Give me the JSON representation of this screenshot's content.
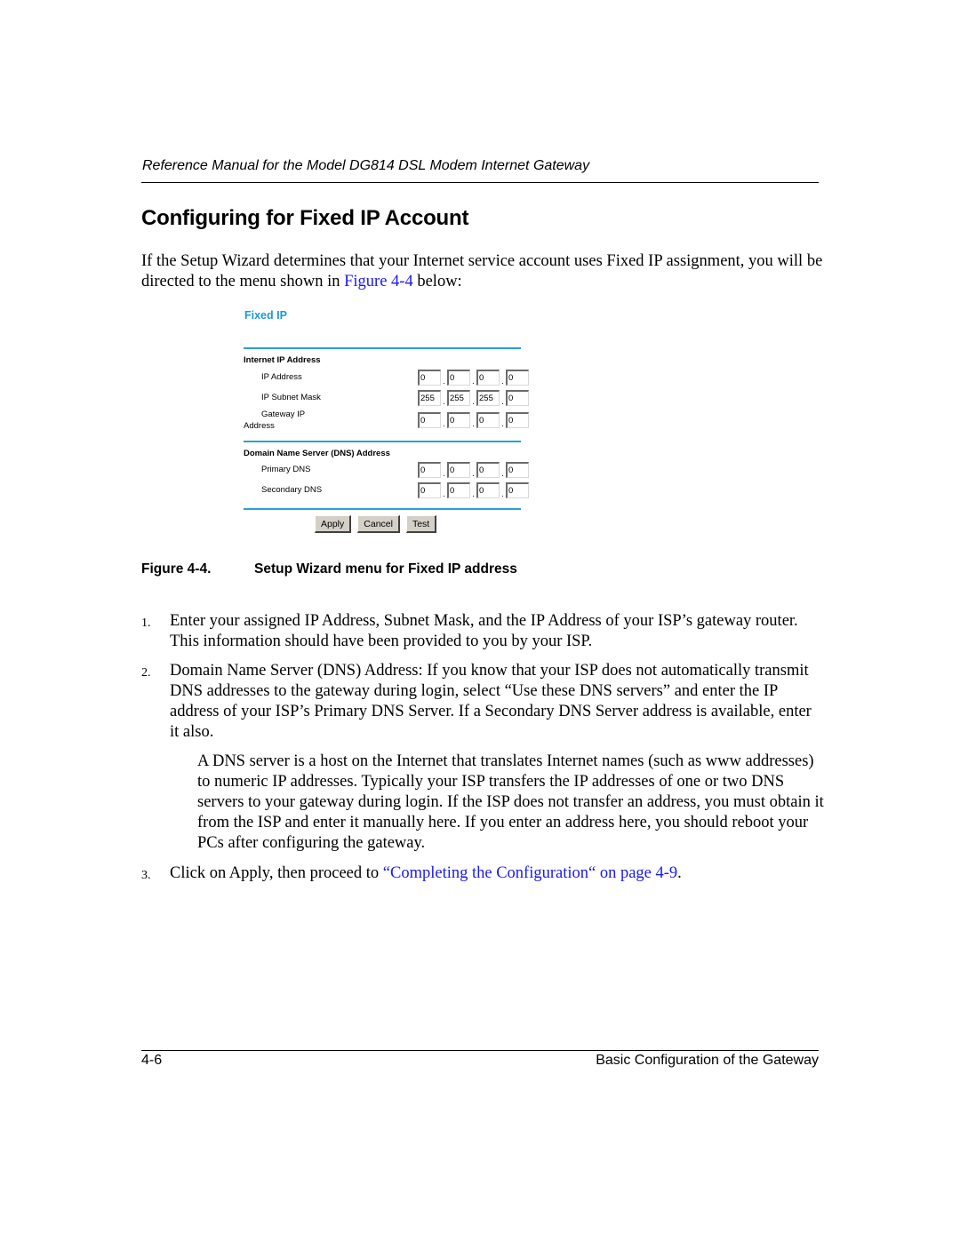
{
  "running_header": "Reference Manual for the Model DG814 DSL Modem Internet Gateway",
  "page_title": "Configuring for Fixed IP Account",
  "intro": {
    "text_before_link": "If the Setup Wizard determines that your Internet service account uses Fixed IP assignment, you will be directed to the menu shown in ",
    "link_text": "Figure 4-4",
    "text_after_link": " below:"
  },
  "figure_ui": {
    "title": "Fixed IP",
    "internet_section": {
      "heading": "Internet IP Address",
      "ip_address": {
        "label": "IP Address",
        "octets": [
          "0",
          "0",
          "0",
          "0"
        ]
      },
      "subnet_mask": {
        "label": "IP Subnet Mask",
        "octets": [
          "255",
          "255",
          "255",
          "0"
        ]
      },
      "gateway_ip": {
        "label_line1": "Gateway IP",
        "label_line2": "Address",
        "octets": [
          "0",
          "0",
          "0",
          "0"
        ]
      }
    },
    "dns_section": {
      "heading": "Domain Name Server (DNS) Address",
      "primary": {
        "label": "Primary DNS",
        "octets": [
          "0",
          "0",
          "0",
          "0"
        ]
      },
      "secondary": {
        "label": "Secondary DNS",
        "octets": [
          "0",
          "0",
          "0",
          "0"
        ]
      }
    },
    "separator": ".",
    "buttons": {
      "apply": "Apply",
      "cancel": "Cancel",
      "test": "Test"
    },
    "accent_color": "#2a9fd6"
  },
  "caption": {
    "number": "Figure 4-4.",
    "title": "Setup Wizard menu for Fixed IP address"
  },
  "steps": [
    {
      "number": "1.",
      "text": "Enter your assigned IP Address, Subnet Mask, and the IP Address of your ISP’s gateway router. This information should have been provided to you by your ISP."
    },
    {
      "number": "2.",
      "text": "Domain Name Server (DNS) Address: If you know that your ISP does not automatically transmit DNS addresses to the gateway during login, select “Use these DNS servers” and enter the IP address of your ISP’s Primary DNS Server. If a Secondary DNS Server address is available, enter it also."
    },
    {
      "number": "3.",
      "text_before_link": "Click on Apply, then proceed to ",
      "link_text": "“Completing the Configuration“ on page 4-9",
      "text_after_link": "."
    }
  ],
  "note": "A DNS server is a host on the Internet that translates Internet names (such as www addresses) to numeric IP addresses. Typically your ISP transfers the IP addresses of one or two DNS servers to your gateway during login. If the ISP does not transfer an address, you must obtain it from the ISP and enter it manually here. If you enter an address here, you should reboot your PCs after configuring the gateway.",
  "footer": {
    "page_number": "4-6",
    "section_title": "Basic Configuration of the Gateway"
  },
  "colors": {
    "link": "#1a1aee",
    "figure_title": "#1b9bd0"
  }
}
